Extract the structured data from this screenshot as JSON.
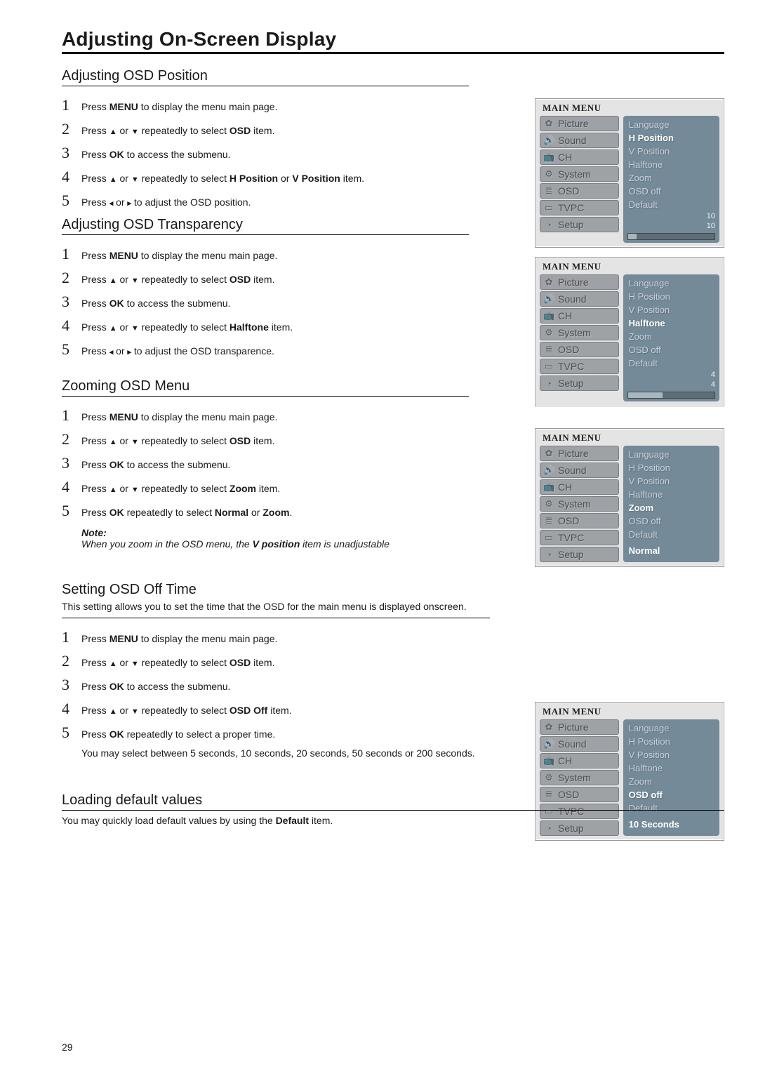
{
  "page_title": "Adjusting On-Screen Display",
  "page_number": "29",
  "menu_title": "MAIN MENU",
  "menu_tabs": [
    "Picture",
    "Sound",
    "CH",
    "System",
    "OSD",
    "TVPC",
    "Setup"
  ],
  "sections": [
    {
      "heading": "Adjusting OSD Position",
      "steps": [
        "Press <b>MENU</b> to display the menu main page.",
        "Press <span class='arrows'>▲</span> or <span class='arrows'>▼</span> repeatedly to select <b>OSD</b> item.",
        "Press <b>OK</b> to access the submenu.",
        "Press <span class='arrows'>▲</span> or <span class='arrows'>▼</span> repeatedly to select <b>H Position</b> or <b>V Position</b> item.",
        "Press <span class='arrows'>◂</span> or <span class='arrows'>▸</span> to adjust the OSD position."
      ],
      "menu": {
        "highlight": "H Position",
        "options": [
          "Language",
          "H Position",
          "V Position",
          "Halftone",
          "Zoom",
          "OSD off",
          "Default"
        ],
        "slider_value": "10",
        "slider_pct": 10
      }
    },
    {
      "heading": "Adjusting OSD Transparency",
      "steps": [
        "Press <b>MENU</b> to display the menu main page.",
        "Press <span class='arrows'>▲</span> or <span class='arrows'>▼</span> repeatedly to select <b>OSD</b> item.",
        "Press <b>OK</b> to access the submenu.",
        "Press <span class='arrows'>▲</span> or <span class='arrows'>▼</span> repeatedly to select <b>Halftone</b> item.",
        "Press <span class='arrows'>◂</span> or <span class='arrows'>▸</span> to adjust the OSD transparence."
      ],
      "menu": {
        "highlight": "Halftone",
        "options": [
          "Language",
          "H Position",
          "V Position",
          "Halftone",
          "Zoom",
          "OSD off",
          "Default"
        ],
        "slider_value": "4",
        "slider_pct": 40
      }
    },
    {
      "heading": "Zooming OSD Menu",
      "steps": [
        "Press <b>MENU</b> to display the menu main page.",
        "Press <span class='arrows'>▲</span> or <span class='arrows'>▼</span> repeatedly to select <b>OSD</b> item.",
        "Press <b>OK</b> to access the submenu.",
        "Press <span class='arrows'>▲</span> or <span class='arrows'>▼</span> repeatedly to select <b>Zoom</b> item.",
        "Press <b>OK</b> repeatedly to select <b>Normal</b> or <b>Zoom</b>."
      ],
      "note": {
        "title": "Note:",
        "body": "When you zoom in the OSD menu, the <b>V position</b> item is unadjustable"
      },
      "menu": {
        "highlight": "Zoom",
        "options": [
          "Language",
          "H Position",
          "V Position",
          "Halftone",
          "Zoom",
          "OSD off",
          "Default"
        ],
        "value_label": "Normal"
      }
    },
    {
      "heading": "Setting OSD  Off Time",
      "desc": "This setting allows you to set the time that the OSD for the main menu is displayed onscreen.",
      "steps": [
        "Press <b>MENU</b> to display the menu main page.",
        "Press <span class='arrows'>▲</span> or <span class='arrows'>▼</span> repeatedly to select <b>OSD</b> item.",
        "Press <b>OK</b> to access the submenu.",
        "Press <span class='arrows'>▲</span> or <span class='arrows'>▼</span> repeatedly to select <b>OSD Off</b> item.",
        "Press <b>OK</b> repeatedly to select a proper time."
      ],
      "subtext": "You may select between 5 seconds, 10 seconds, 20 seconds, 50 seconds or 200 seconds.",
      "menu": {
        "highlight": "OSD off",
        "options": [
          "Language",
          "H Position",
          "V Position",
          "Halftone",
          "Zoom",
          "OSD off",
          "Default"
        ],
        "value_label": "10 Seconds"
      }
    },
    {
      "heading": "Loading default values",
      "desc_after": "You may quickly load default values  by using the <b>Default</b> item."
    }
  ],
  "tab_icons": [
    "✿",
    "🔊",
    "📺",
    "⚙",
    "≣",
    "▭",
    "◔"
  ]
}
